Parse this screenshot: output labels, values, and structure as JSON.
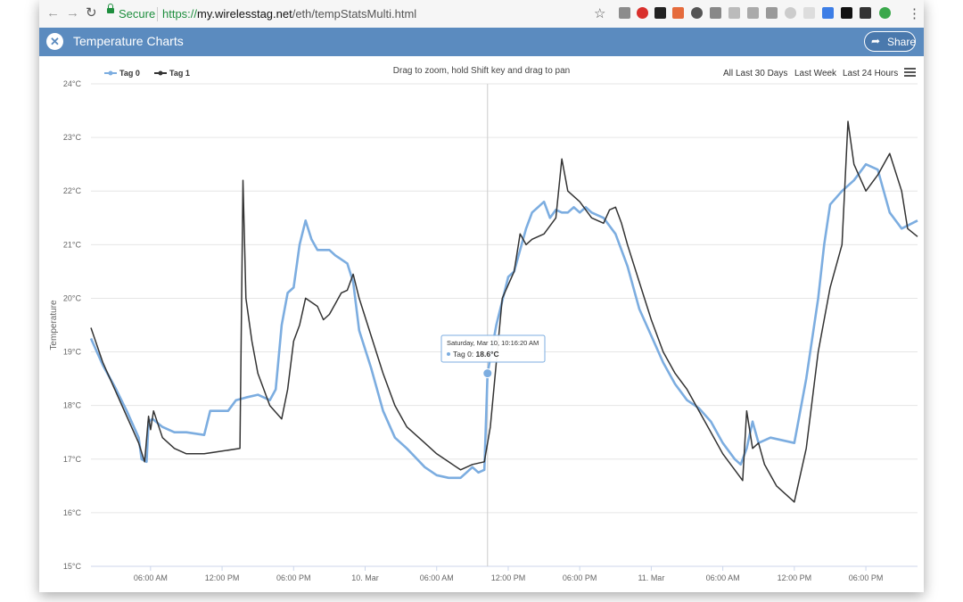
{
  "browser": {
    "back_icon": "arrow-left-icon",
    "forward_icon": "arrow-right-icon",
    "reload_icon": "reload-icon",
    "secure_label": "Secure",
    "url_protocol": "https://",
    "url_host": "my.wirelesstag.net",
    "url_path": "/eth/tempStatsMulti.html",
    "bookmark_icon": "star-icon",
    "menu_icon": "vertical-dots-icon"
  },
  "app": {
    "close_icon": "close-icon",
    "title": "Temperature Charts",
    "share_icon": "share-arrow-icon",
    "share_label": "Share"
  },
  "controls": {
    "hint": "Drag to zoom, hold Shift key and drag to pan",
    "ranges": [
      "All",
      "Last 30 Days",
      "Last Week",
      "Last 24 Hours"
    ],
    "menu_icon": "hamburger-icon"
  },
  "tooltip": {
    "timestamp": "Saturday, Mar 10, 10:16:20 AM",
    "series": "Tag 0",
    "value": "18.6°C"
  },
  "colors": {
    "tag0": "#7cade0",
    "tag1": "#333333",
    "appbar": "#5b8bbf"
  },
  "chart_data": {
    "type": "line",
    "title": "",
    "ylabel": "Temperature",
    "ylim": [
      15,
      24
    ],
    "y_ticks": [
      15,
      16,
      17,
      18,
      19,
      20,
      21,
      22,
      23,
      24
    ],
    "y_tick_labels": [
      "15°C",
      "16°C",
      "17°C",
      "18°C",
      "19°C",
      "20°C",
      "21°C",
      "22°C",
      "23°C",
      "24°C"
    ],
    "x_start": "2018-03-09T01:00",
    "x_end": "2018-03-11T22:20",
    "x_ticks": [
      "2018-03-09T06:00",
      "2018-03-09T12:00",
      "2018-03-09T18:00",
      "2018-03-10T00:00",
      "2018-03-10T06:00",
      "2018-03-10T12:00",
      "2018-03-10T18:00",
      "2018-03-11T00:00",
      "2018-03-11T06:00",
      "2018-03-11T12:00",
      "2018-03-11T18:00"
    ],
    "x_tick_labels": [
      "06:00 AM",
      "12:00 PM",
      "06:00 PM",
      "10. Mar",
      "06:00 AM",
      "12:00 PM",
      "06:00 PM",
      "11. Mar",
      "06:00 AM",
      "12:00 PM",
      "06:00 PM"
    ],
    "grid": true,
    "legend": "top-left",
    "series": [
      {
        "name": "Tag 0",
        "color": "#7cade0",
        "points": [
          [
            "2018-03-09T01:00",
            19.25
          ],
          [
            "2018-03-09T02:00",
            18.75
          ],
          [
            "2018-03-09T03:00",
            18.35
          ],
          [
            "2018-03-09T04:00",
            17.9
          ],
          [
            "2018-03-09T05:00",
            17.4
          ],
          [
            "2018-03-09T05:15",
            17.0
          ],
          [
            "2018-03-09T05:40",
            16.95
          ],
          [
            "2018-03-09T05:50",
            17.7
          ],
          [
            "2018-03-09T06:10",
            17.75
          ],
          [
            "2018-03-09T07:00",
            17.6
          ],
          [
            "2018-03-09T08:00",
            17.5
          ],
          [
            "2018-03-09T09:00",
            17.5
          ],
          [
            "2018-03-09T10:30",
            17.45
          ],
          [
            "2018-03-09T11:00",
            17.9
          ],
          [
            "2018-03-09T12:30",
            17.9
          ],
          [
            "2018-03-09T13:10",
            18.1
          ],
          [
            "2018-03-09T14:00",
            18.15
          ],
          [
            "2018-03-09T15:00",
            18.2
          ],
          [
            "2018-03-09T16:00",
            18.1
          ],
          [
            "2018-03-09T16:30",
            18.3
          ],
          [
            "2018-03-09T17:00",
            19.5
          ],
          [
            "2018-03-09T17:30",
            20.1
          ],
          [
            "2018-03-09T18:00",
            20.2
          ],
          [
            "2018-03-09T18:30",
            21.0
          ],
          [
            "2018-03-09T19:00",
            21.45
          ],
          [
            "2018-03-09T19:30",
            21.1
          ],
          [
            "2018-03-09T20:00",
            20.9
          ],
          [
            "2018-03-09T21:00",
            20.9
          ],
          [
            "2018-03-09T21:30",
            20.8
          ],
          [
            "2018-03-09T22:30",
            20.65
          ],
          [
            "2018-03-09T23:00",
            20.3
          ],
          [
            "2018-03-09T23:30",
            19.4
          ],
          [
            "2018-03-10T00:30",
            18.7
          ],
          [
            "2018-03-10T01:30",
            17.9
          ],
          [
            "2018-03-10T02:30",
            17.4
          ],
          [
            "2018-03-10T03:30",
            17.2
          ],
          [
            "2018-03-10T05:00",
            16.85
          ],
          [
            "2018-03-10T06:00",
            16.7
          ],
          [
            "2018-03-10T07:00",
            16.65
          ],
          [
            "2018-03-10T08:00",
            16.65
          ],
          [
            "2018-03-10T08:30",
            16.75
          ],
          [
            "2018-03-10T09:00",
            16.85
          ],
          [
            "2018-03-10T09:30",
            16.75
          ],
          [
            "2018-03-10T10:00",
            16.8
          ],
          [
            "2018-03-10T10:16",
            18.6
          ],
          [
            "2018-03-10T11:00",
            19.5
          ],
          [
            "2018-03-10T12:00",
            20.4
          ],
          [
            "2018-03-10T12:30",
            20.5
          ],
          [
            "2018-03-10T13:00",
            20.9
          ],
          [
            "2018-03-10T13:30",
            21.3
          ],
          [
            "2018-03-10T14:00",
            21.6
          ],
          [
            "2018-03-10T14:30",
            21.7
          ],
          [
            "2018-03-10T15:00",
            21.8
          ],
          [
            "2018-03-10T15:30",
            21.5
          ],
          [
            "2018-03-10T16:00",
            21.65
          ],
          [
            "2018-03-10T16:30",
            21.6
          ],
          [
            "2018-03-10T17:00",
            21.6
          ],
          [
            "2018-03-10T17:30",
            21.7
          ],
          [
            "2018-03-10T18:00",
            21.6
          ],
          [
            "2018-03-10T18:30",
            21.7
          ],
          [
            "2018-03-10T19:00",
            21.6
          ],
          [
            "2018-03-10T20:00",
            21.5
          ],
          [
            "2018-03-10T21:00",
            21.2
          ],
          [
            "2018-03-10T22:00",
            20.6
          ],
          [
            "2018-03-10T23:00",
            19.8
          ],
          [
            "2018-03-11T00:00",
            19.3
          ],
          [
            "2018-03-11T01:00",
            18.8
          ],
          [
            "2018-03-11T02:00",
            18.4
          ],
          [
            "2018-03-11T03:00",
            18.1
          ],
          [
            "2018-03-11T04:00",
            17.95
          ],
          [
            "2018-03-11T05:00",
            17.7
          ],
          [
            "2018-03-11T06:00",
            17.3
          ],
          [
            "2018-03-11T07:00",
            17.0
          ],
          [
            "2018-03-11T07:30",
            16.9
          ],
          [
            "2018-03-11T08:00",
            17.2
          ],
          [
            "2018-03-11T08:30",
            17.7
          ],
          [
            "2018-03-11T09:00",
            17.3
          ],
          [
            "2018-03-11T10:00",
            17.4
          ],
          [
            "2018-03-11T11:00",
            17.35
          ],
          [
            "2018-03-11T12:00",
            17.3
          ],
          [
            "2018-03-11T13:00",
            18.5
          ],
          [
            "2018-03-11T14:00",
            20.0
          ],
          [
            "2018-03-11T14:30",
            21.0
          ],
          [
            "2018-03-11T15:00",
            21.75
          ],
          [
            "2018-03-11T16:00",
            22.0
          ],
          [
            "2018-03-11T17:00",
            22.2
          ],
          [
            "2018-03-11T18:00",
            22.5
          ],
          [
            "2018-03-11T19:00",
            22.4
          ],
          [
            "2018-03-11T20:00",
            21.6
          ],
          [
            "2018-03-11T21:00",
            21.3
          ],
          [
            "2018-03-11T22:20",
            21.45
          ]
        ]
      },
      {
        "name": "Tag 1",
        "color": "#333333",
        "points": [
          [
            "2018-03-09T01:00",
            19.45
          ],
          [
            "2018-03-09T02:00",
            18.8
          ],
          [
            "2018-03-09T03:00",
            18.3
          ],
          [
            "2018-03-09T04:00",
            17.8
          ],
          [
            "2018-03-09T05:00",
            17.3
          ],
          [
            "2018-03-09T05:30",
            16.95
          ],
          [
            "2018-03-09T05:50",
            17.8
          ],
          [
            "2018-03-09T06:00",
            17.55
          ],
          [
            "2018-03-09T06:15",
            17.9
          ],
          [
            "2018-03-09T07:00",
            17.4
          ],
          [
            "2018-03-09T08:00",
            17.2
          ],
          [
            "2018-03-09T09:00",
            17.1
          ],
          [
            "2018-03-09T10:30",
            17.1
          ],
          [
            "2018-03-09T12:00",
            17.15
          ],
          [
            "2018-03-09T13:30",
            17.2
          ],
          [
            "2018-03-09T13:45",
            22.2
          ],
          [
            "2018-03-09T14:00",
            20.0
          ],
          [
            "2018-03-09T14:30",
            19.2
          ],
          [
            "2018-03-09T15:00",
            18.6
          ],
          [
            "2018-03-09T16:00",
            18.0
          ],
          [
            "2018-03-09T17:00",
            17.75
          ],
          [
            "2018-03-09T17:30",
            18.3
          ],
          [
            "2018-03-09T18:00",
            19.2
          ],
          [
            "2018-03-09T18:30",
            19.5
          ],
          [
            "2018-03-09T19:00",
            20.0
          ],
          [
            "2018-03-09T20:00",
            19.85
          ],
          [
            "2018-03-09T20:30",
            19.6
          ],
          [
            "2018-03-09T21:00",
            19.7
          ],
          [
            "2018-03-09T21:30",
            19.9
          ],
          [
            "2018-03-09T22:00",
            20.1
          ],
          [
            "2018-03-09T22:30",
            20.15
          ],
          [
            "2018-03-09T23:00",
            20.45
          ],
          [
            "2018-03-09T23:30",
            20.0
          ],
          [
            "2018-03-10T00:30",
            19.3
          ],
          [
            "2018-03-10T01:30",
            18.6
          ],
          [
            "2018-03-10T02:30",
            18.0
          ],
          [
            "2018-03-10T03:30",
            17.6
          ],
          [
            "2018-03-10T05:00",
            17.3
          ],
          [
            "2018-03-10T06:00",
            17.1
          ],
          [
            "2018-03-10T07:00",
            16.95
          ],
          [
            "2018-03-10T08:00",
            16.8
          ],
          [
            "2018-03-10T09:00",
            16.9
          ],
          [
            "2018-03-10T10:00",
            16.95
          ],
          [
            "2018-03-10T10:30",
            17.6
          ],
          [
            "2018-03-10T11:00",
            18.8
          ],
          [
            "2018-03-10T11:30",
            20.0
          ],
          [
            "2018-03-10T12:30",
            20.5
          ],
          [
            "2018-03-10T13:00",
            21.2
          ],
          [
            "2018-03-10T13:30",
            21.0
          ],
          [
            "2018-03-10T14:00",
            21.1
          ],
          [
            "2018-03-10T15:00",
            21.2
          ],
          [
            "2018-03-10T16:00",
            21.5
          ],
          [
            "2018-03-10T16:30",
            22.6
          ],
          [
            "2018-03-10T17:00",
            22.0
          ],
          [
            "2018-03-10T18:00",
            21.8
          ],
          [
            "2018-03-10T19:00",
            21.5
          ],
          [
            "2018-03-10T20:00",
            21.4
          ],
          [
            "2018-03-10T20:30",
            21.65
          ],
          [
            "2018-03-10T21:00",
            21.7
          ],
          [
            "2018-03-10T21:30",
            21.4
          ],
          [
            "2018-03-10T22:00",
            21.0
          ],
          [
            "2018-03-10T23:00",
            20.3
          ],
          [
            "2018-03-11T00:00",
            19.6
          ],
          [
            "2018-03-11T01:00",
            19.0
          ],
          [
            "2018-03-11T02:00",
            18.6
          ],
          [
            "2018-03-11T03:00",
            18.3
          ],
          [
            "2018-03-11T04:00",
            17.9
          ],
          [
            "2018-03-11T05:00",
            17.5
          ],
          [
            "2018-03-11T06:00",
            17.1
          ],
          [
            "2018-03-11T07:00",
            16.8
          ],
          [
            "2018-03-11T07:40",
            16.6
          ],
          [
            "2018-03-11T08:00",
            17.9
          ],
          [
            "2018-03-11T08:30",
            17.2
          ],
          [
            "2018-03-11T09:00",
            17.3
          ],
          [
            "2018-03-11T09:30",
            16.9
          ],
          [
            "2018-03-11T10:30",
            16.5
          ],
          [
            "2018-03-11T11:30",
            16.3
          ],
          [
            "2018-03-11T12:00",
            16.2
          ],
          [
            "2018-03-11T13:00",
            17.2
          ],
          [
            "2018-03-11T14:00",
            19.0
          ],
          [
            "2018-03-11T15:00",
            20.2
          ],
          [
            "2018-03-11T16:00",
            21.0
          ],
          [
            "2018-03-11T16:30",
            23.3
          ],
          [
            "2018-03-11T17:00",
            22.5
          ],
          [
            "2018-03-11T18:00",
            22.0
          ],
          [
            "2018-03-11T19:00",
            22.3
          ],
          [
            "2018-03-11T20:00",
            22.7
          ],
          [
            "2018-03-11T21:00",
            22.0
          ],
          [
            "2018-03-11T21:30",
            21.3
          ],
          [
            "2018-03-11T22:20",
            21.15
          ]
        ]
      }
    ]
  }
}
